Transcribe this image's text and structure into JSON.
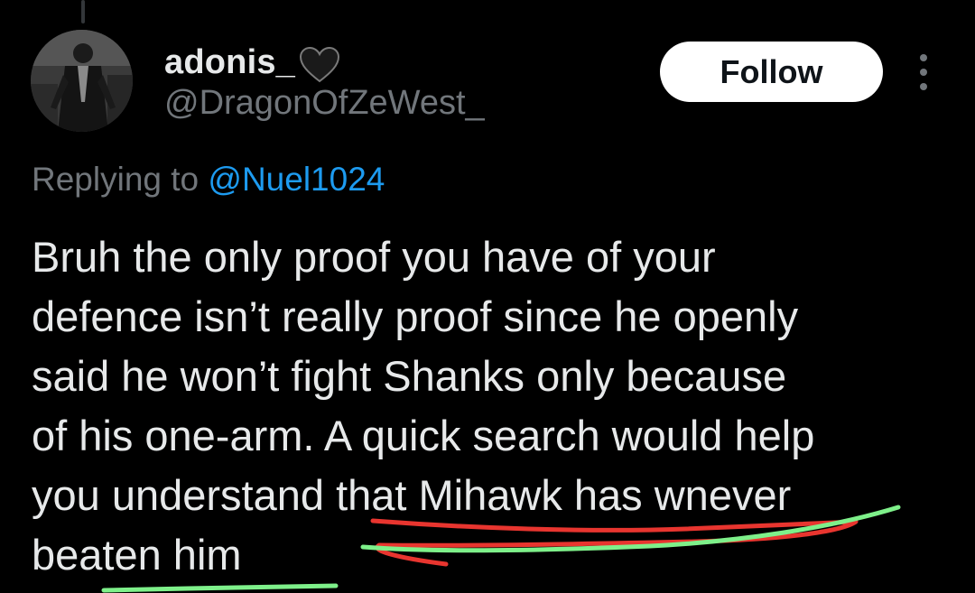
{
  "author": {
    "display_name": "adonis_",
    "handle": "@DragonOfZeWest_",
    "name_emoji": "black-heart-icon"
  },
  "actions": {
    "follow_label": "Follow",
    "more_icon": "more-vertical-icon"
  },
  "reply_context": {
    "prefix": "Replying to",
    "mention": "@Nuel1024"
  },
  "tweet": {
    "lines": [
      "Bruh the only proof you have of your",
      "defence isn’t really proof since he openly",
      "said he won’t fight Shanks only because",
      "of his one-arm. A quick search would help",
      "you understand that Mihawk has wnever",
      "beaten him"
    ]
  },
  "colors": {
    "background": "#000000",
    "text_primary": "#e7e9ea",
    "text_secondary": "#71767b",
    "link": "#1d9bf0",
    "follow_bg": "#ffffff",
    "annotation_red": "#e8352f",
    "annotation_green": "#7ef08a"
  }
}
